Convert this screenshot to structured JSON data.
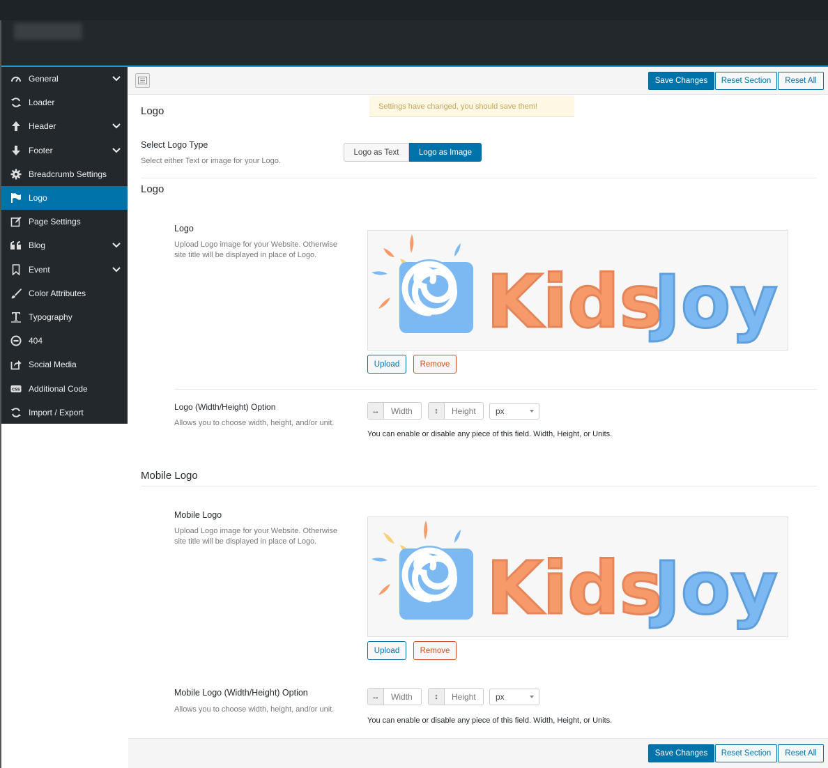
{
  "sidebar": {
    "items": [
      {
        "label": "General",
        "icon": "dashboard-icon",
        "has_children": true
      },
      {
        "label": "Loader",
        "icon": "refresh-icon",
        "has_children": false
      },
      {
        "label": "Header",
        "icon": "arrow-up-icon",
        "has_children": true
      },
      {
        "label": "Footer",
        "icon": "arrow-down-icon",
        "has_children": true
      },
      {
        "label": "Breadcrumb Settings",
        "icon": "gear-icon",
        "has_children": false
      },
      {
        "label": "Logo",
        "icon": "flag-icon",
        "has_children": false,
        "active": true
      },
      {
        "label": "Page Settings",
        "icon": "edit-icon",
        "has_children": false
      },
      {
        "label": "Blog",
        "icon": "quote-icon",
        "has_children": true
      },
      {
        "label": "Event",
        "icon": "bookmark-icon",
        "has_children": true
      },
      {
        "label": "Color Attributes",
        "icon": "brush-icon",
        "has_children": false
      },
      {
        "label": "Typography",
        "icon": "text-icon",
        "has_children": false
      },
      {
        "label": "404",
        "icon": "minus-circle-icon",
        "has_children": false
      },
      {
        "label": "Social Media",
        "icon": "share-icon",
        "has_children": false
      },
      {
        "label": "Additional Code",
        "icon": "css-icon",
        "has_children": false
      },
      {
        "label": "Import / Export",
        "icon": "refresh-icon",
        "has_children": false
      }
    ]
  },
  "toolbar": {
    "save_label": "Save Changes",
    "reset_section_label": "Reset Section",
    "reset_all_label": "Reset All"
  },
  "notice": "Settings have changed, you should save them!",
  "section_logo_header": "Logo",
  "logo_type": {
    "label": "Select Logo Type",
    "desc": "Select either Text or image for your Logo.",
    "option_text": "Logo as Text",
    "option_image": "Logo as Image",
    "selected": "Logo as Image"
  },
  "section_logo": "Logo",
  "logo_field": {
    "label": "Logo",
    "desc_line1": "Upload Logo image for your Website. Otherwise",
    "desc_line2": "site title will be displayed in place of Logo.",
    "upload_label": "Upload",
    "remove_label": "Remove",
    "logo_text_kids": "Kids",
    "logo_text_joy": "Joy"
  },
  "logo_dims": {
    "label": "Logo (Width/Height) Option",
    "desc": "Allows you to choose width, height, and/or unit.",
    "width_placeholder": "Width",
    "height_placeholder": "Height",
    "unit": "px",
    "note": "You can enable or disable any piece of this field. Width, Height, or Units."
  },
  "section_mobile_logo": "Mobile Logo",
  "mobile_logo_field": {
    "label": "Mobile Logo",
    "desc_line1": "Upload Logo image for your Website. Otherwise",
    "desc_line2": "site title will be displayed in place of Logo.",
    "upload_label": "Upload",
    "remove_label": "Remove",
    "logo_text_kids": "Kids",
    "logo_text_joy": "Joy"
  },
  "mobile_logo_dims": {
    "label": "Mobile Logo (Width/Height) Option",
    "desc": "Allows you to choose width, height, and/or unit.",
    "width_placeholder": "Width",
    "height_placeholder": "Height",
    "unit": "px",
    "note": "You can enable or disable any piece of this field. Width, Height, or Units."
  },
  "colors": {
    "accent": "#0073aa",
    "sidebar_bg": "#23282d",
    "logo_orange": "#f79a6a",
    "logo_blue": "#7cb8f2"
  }
}
